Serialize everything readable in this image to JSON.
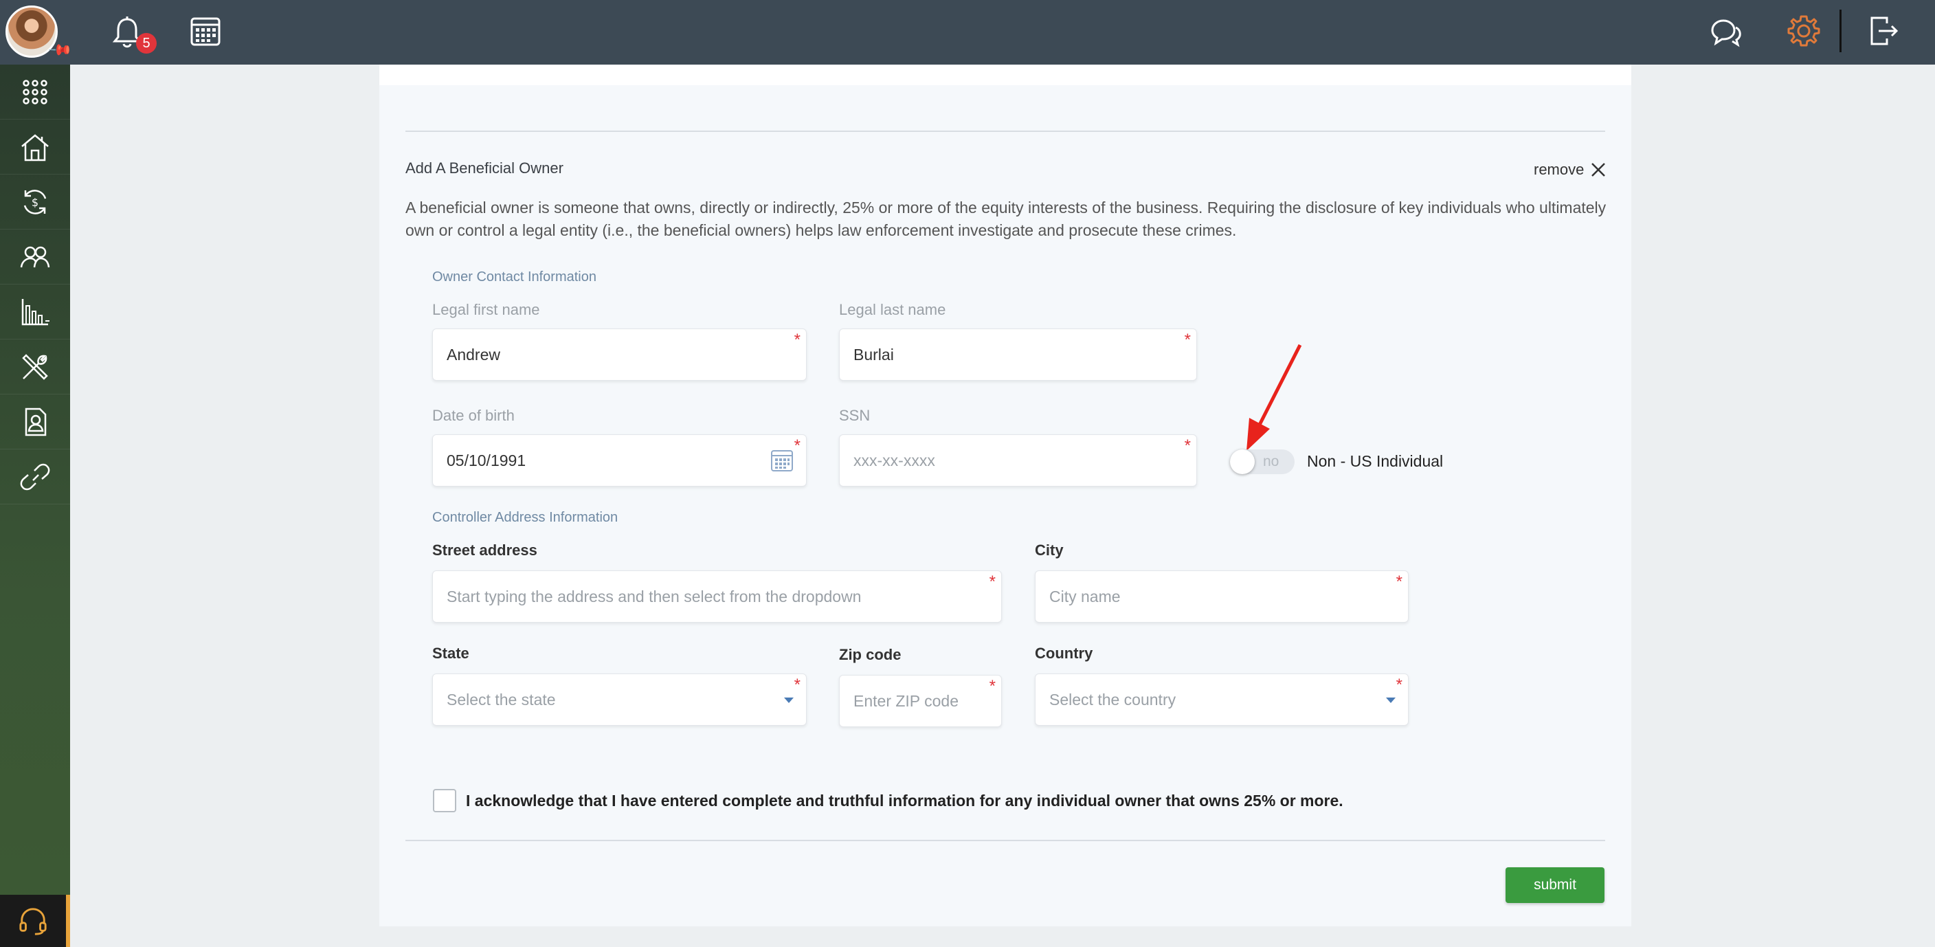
{
  "topbar": {
    "notification_count": "5"
  },
  "card": {
    "title": "Add A Beneficial Owner",
    "remove_label": "remove",
    "description": "A beneficial owner is someone that owns, directly or indirectly, 25% or more of the equity interests of the business. Requiring the disclosure of key individuals who ultimately own or control a legal entity (i.e., the beneficial owners) helps law enforcement investigate and prosecute these crimes."
  },
  "owner_contact": {
    "group_label": "Owner Contact Information",
    "first_name": {
      "label": "Legal first name",
      "value": "Andrew"
    },
    "last_name": {
      "label": "Legal last name",
      "value": "Burlai"
    },
    "dob": {
      "label": "Date of birth",
      "value": "05/10/1991"
    },
    "ssn": {
      "label": "SSN",
      "placeholder": "xxx-xx-xxxx"
    },
    "non_us": {
      "toggle_value": "no",
      "label": "Non - US Individual"
    }
  },
  "address": {
    "group_label": "Controller Address Information",
    "street": {
      "label": "Street address",
      "placeholder": "Start typing the address and then select from the dropdown"
    },
    "city": {
      "label": "City",
      "placeholder": "City name"
    },
    "state": {
      "label": "State",
      "placeholder": "Select the state"
    },
    "zip": {
      "label": "Zip code",
      "placeholder": "Enter ZIP code"
    },
    "country": {
      "label": "Country",
      "placeholder": "Select the country"
    }
  },
  "acknowledgement": "I acknowledge that I have entered complete and truthful information for any individual owner that owns 25% or more.",
  "submit_label": "submit",
  "colors": {
    "topbar": "#3d4a55",
    "accent_orange": "#e07a3a",
    "submit_green": "#3a9b3f",
    "required_red": "#e0353b",
    "arrow_red": "#e8231c"
  },
  "icons": {
    "sidebar": [
      "apps-grid-icon",
      "home-icon",
      "money-exchange-icon",
      "users-icon",
      "bar-chart-icon",
      "tools-icon",
      "contact-card-icon",
      "link-icon"
    ],
    "sidebar_bottom": "headset-icon"
  }
}
